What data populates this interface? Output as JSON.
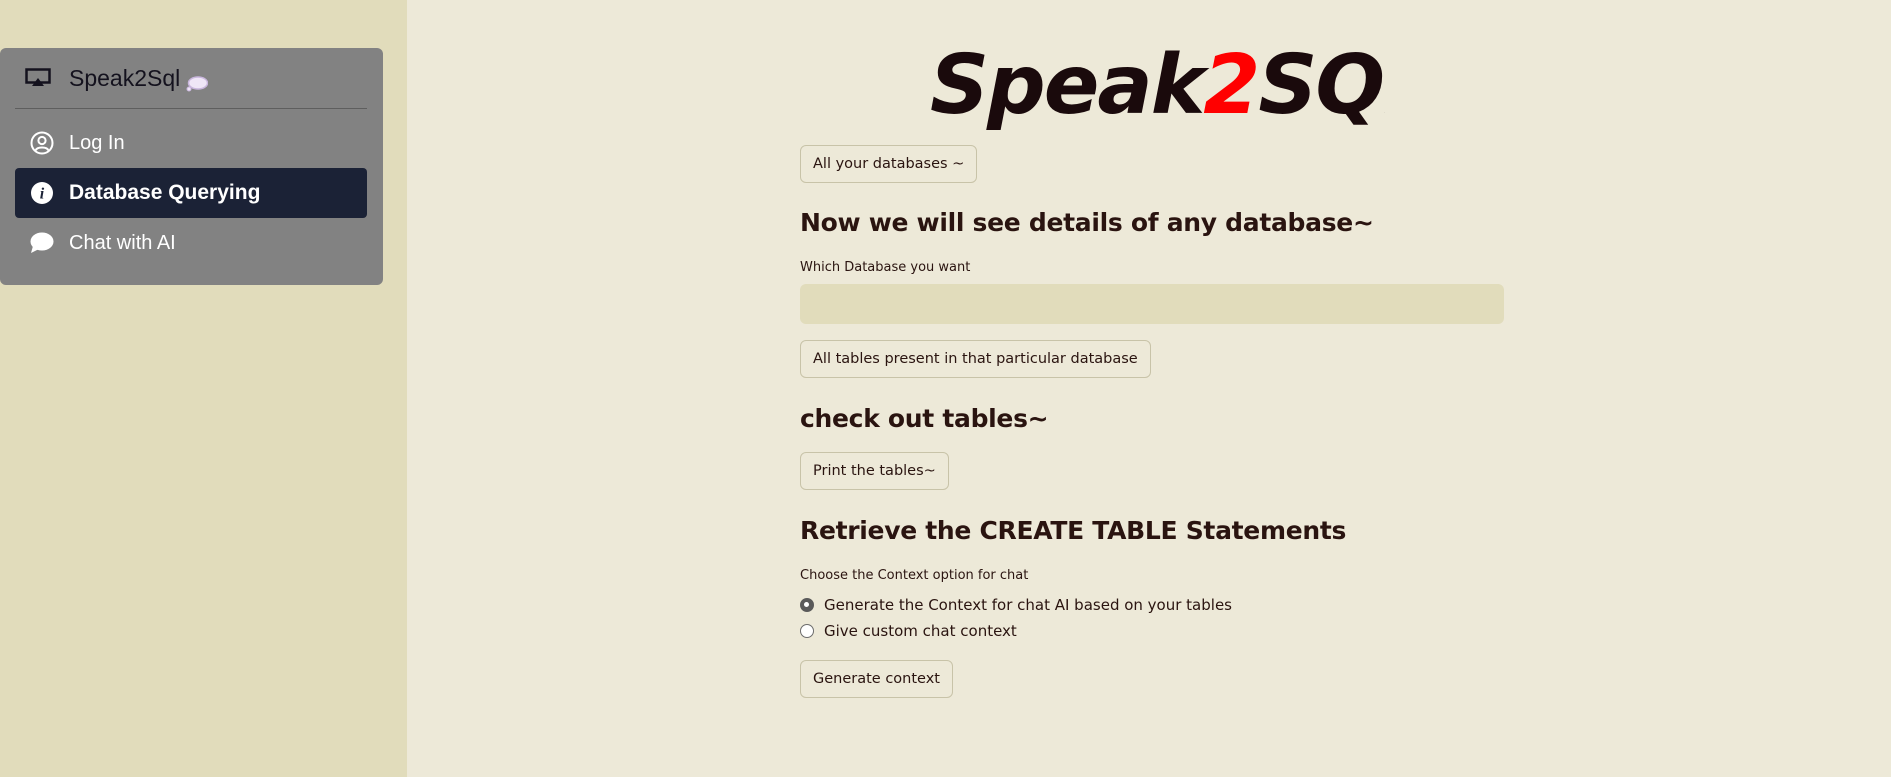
{
  "sidebar": {
    "title": "Speak2Sql",
    "items": [
      {
        "label": "Log In",
        "icon": "user-circle-icon",
        "active": false
      },
      {
        "label": "Database Querying",
        "icon": "info-icon",
        "active": true
      },
      {
        "label": "Chat with AI",
        "icon": "chat-bubble-icon",
        "active": false
      }
    ]
  },
  "logo": {
    "part1": "Speak",
    "part2": "2",
    "part3": "SQL",
    "accent_color": "#ff0000"
  },
  "main": {
    "btn_databases": "All your databases ~",
    "heading_details": "Now we will see details of any database~",
    "label_which_db": "Which Database you want",
    "db_input_value": "",
    "btn_tables": "All tables present in that particular database",
    "heading_check": "check out tables~",
    "btn_print": "Print the tables~",
    "heading_retrieve": "Retrieve the CREATE TABLE Statements",
    "label_context": "Choose the Context option for chat",
    "radio_options": [
      {
        "label": "Generate the Context for chat AI based on your tables",
        "checked": true
      },
      {
        "label": "Give custom chat context",
        "checked": false
      }
    ],
    "btn_generate": "Generate context"
  },
  "colors": {
    "page_bg": "#ede9d8",
    "sidebar_bg": "#e1dcbb",
    "menu_bg": "#828282",
    "active_item_bg": "#1b2236"
  }
}
